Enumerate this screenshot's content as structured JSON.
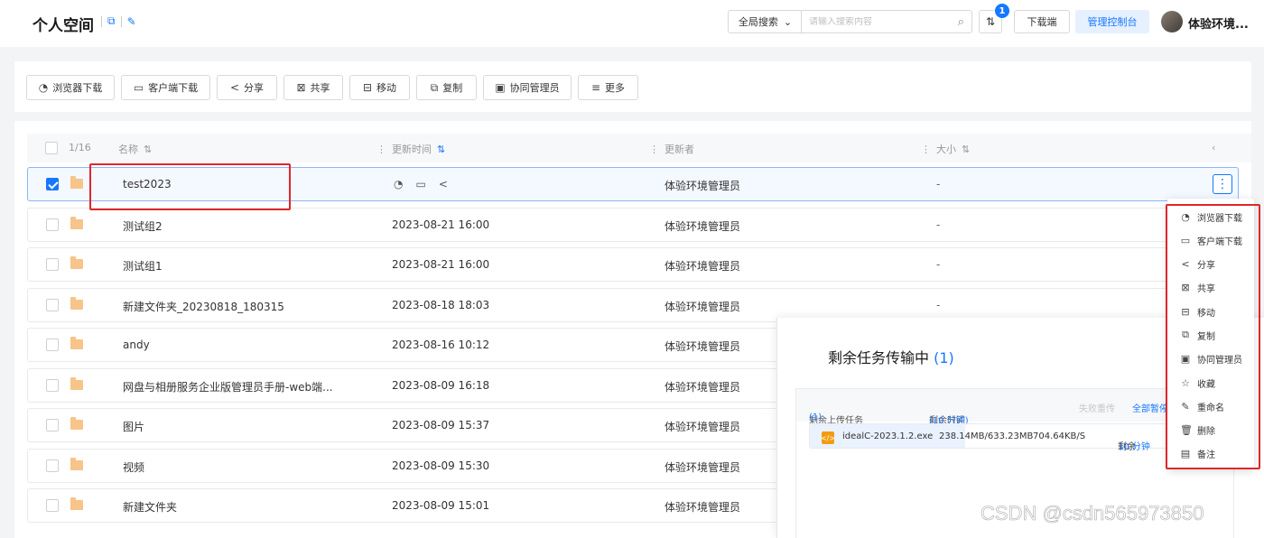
{
  "header": {
    "title": "个人空间",
    "search_scope": "全局搜索",
    "search_placeholder": "请输入搜索内容",
    "transfer_badge": "1",
    "download_label": "下载端",
    "admin_label": "管理控制台",
    "user_name": "体验环境..."
  },
  "toolbar": {
    "buttons": [
      {
        "label": "浏览器下载",
        "icon": "browser-icon"
      },
      {
        "label": "客户端下载",
        "icon": "monitor-icon"
      },
      {
        "label": "分享",
        "icon": "share-icon"
      },
      {
        "label": "共享",
        "icon": "shared-icon"
      },
      {
        "label": "移动",
        "icon": "move-icon"
      },
      {
        "label": "复制",
        "icon": "copy-icon"
      },
      {
        "label": "协同管理员",
        "icon": "collaborate-icon"
      },
      {
        "label": "更多",
        "icon": "list-icon"
      }
    ]
  },
  "table": {
    "selection_count": "1/16",
    "columns": {
      "name": "名称",
      "time": "更新时间",
      "updater": "更新者",
      "size": "大小"
    },
    "rows": [
      {
        "name": "test2023",
        "time": "",
        "updater": "体验环境管理员",
        "size": "-"
      },
      {
        "name": "测试组2",
        "time": "2023-08-21 16:00",
        "updater": "体验环境管理员",
        "size": "-"
      },
      {
        "name": "测试组1",
        "time": "2023-08-21 16:00",
        "updater": "体验环境管理员",
        "size": "-"
      },
      {
        "name": "新建文件夹_20230818_180315",
        "time": "2023-08-18 18:03",
        "updater": "体验环境管理员",
        "size": "-"
      },
      {
        "name": "andy",
        "time": "2023-08-16 10:12",
        "updater": "体验环境管理员",
        "size": "-"
      },
      {
        "name": "网盘与相册服务企业版管理员手册-web端...",
        "time": "2023-08-09 16:18",
        "updater": "体验环境管理员",
        "size": ""
      },
      {
        "name": "图片",
        "time": "2023-08-09 15:37",
        "updater": "体验环境管理员",
        "size": ""
      },
      {
        "name": "视频",
        "time": "2023-08-09 15:30",
        "updater": "体验环境管理员",
        "size": ""
      },
      {
        "name": "新建文件夹",
        "time": "2023-08-09 15:01",
        "updater": "体验环境管理员",
        "size": ""
      }
    ]
  },
  "transfer": {
    "title": "剩余任务传输中",
    "count": "(1)",
    "upload_tasks": "剩余上传任务",
    "upload_count": "(1)",
    "remaining_time_label": "剩余时间",
    "remaining_time": "(10 分钟)",
    "retry_failed": "失败重传",
    "pause_all": "全部暂停",
    "file": {
      "name": "idealC-2023.1.2.exe",
      "progress": "238.14MB/633.23MB",
      "progress_fraction": 0.376,
      "speed": "704.64KB/S",
      "remaining_label": "剩余",
      "remaining_value": "10 分钟"
    }
  },
  "context_menu": [
    {
      "label": "浏览器下载",
      "icon": "browser-icon"
    },
    {
      "label": "客户端下载",
      "icon": "monitor-icon"
    },
    {
      "label": "分享",
      "icon": "share-icon"
    },
    {
      "label": "共享",
      "icon": "shared-icon"
    },
    {
      "label": "移动",
      "icon": "move-icon"
    },
    {
      "label": "复制",
      "icon": "copy-icon"
    },
    {
      "label": "协同管理员",
      "icon": "collaborate-icon"
    },
    {
      "label": "收藏",
      "icon": "star-icon"
    },
    {
      "label": "重命名",
      "icon": "edit-icon"
    },
    {
      "label": "删除",
      "icon": "trash-icon"
    },
    {
      "label": "备注",
      "icon": "note-icon"
    }
  ],
  "watermark": "CSDN @csdn565973850",
  "colors": {
    "accent": "#1677ff",
    "highlight": "#e0262b",
    "folder": "#f7c48a"
  }
}
